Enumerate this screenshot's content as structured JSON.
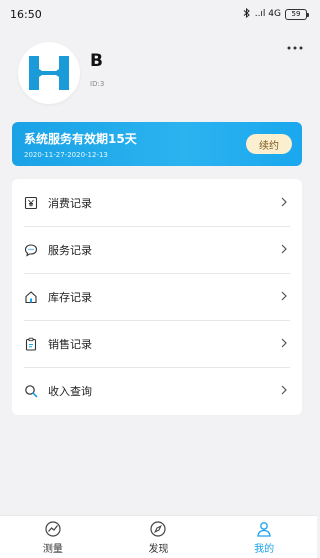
{
  "status_bar": {
    "time": "16:50",
    "network": "..ıl 4G",
    "battery": "59"
  },
  "profile": {
    "name": "B",
    "id_text": "ID:3"
  },
  "service": {
    "title": "系统服务有效期15天",
    "dates": "2020-11-27-2020-12-13",
    "renew_label": "续约"
  },
  "menu": {
    "items": [
      {
        "label": "消费记录",
        "icon": "yen-receipt-icon"
      },
      {
        "label": "服务记录",
        "icon": "chat-bubble-icon"
      },
      {
        "label": "库存记录",
        "icon": "house-icon"
      },
      {
        "label": "销售记录",
        "icon": "clipboard-icon"
      },
      {
        "label": "收入查询",
        "icon": "search-icon"
      }
    ]
  },
  "nav": {
    "items": [
      {
        "label": "测量",
        "icon": "gauge-icon",
        "active": false
      },
      {
        "label": "发现",
        "icon": "compass-icon",
        "active": false
      },
      {
        "label": "我的",
        "icon": "user-icon",
        "active": true
      }
    ]
  },
  "colors": {
    "accent": "#1aa3e8",
    "renew_bg": "#fbefcf",
    "logo": "#1a9ad6"
  }
}
